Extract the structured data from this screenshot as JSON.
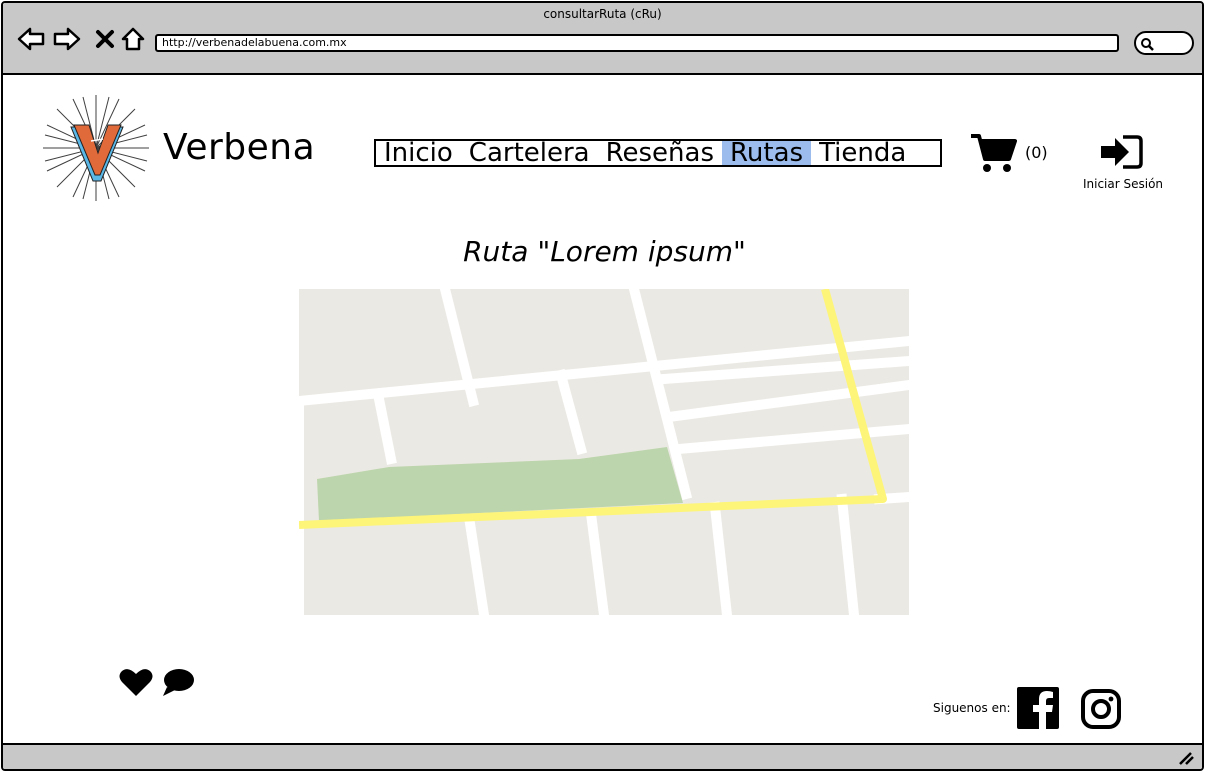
{
  "window": {
    "title": "consultarRuta (cRu)",
    "url": "http://verbenadelabuena.com.mx"
  },
  "header": {
    "brand": "Verbena",
    "nav": [
      {
        "label": "Inicio"
      },
      {
        "label": "Cartelera"
      },
      {
        "label": "Reseñas"
      },
      {
        "label": "Rutas",
        "active": true
      },
      {
        "label": "Tienda"
      }
    ],
    "cart_count": "(0)",
    "login_label": "Iniciar Sesión"
  },
  "main": {
    "route_title": "Ruta \"Lorem ipsum\""
  },
  "footer": {
    "follow_label": "Siguenos en:",
    "icons": [
      "heart-icon",
      "comment-icon",
      "facebook-icon",
      "instagram-icon"
    ]
  },
  "colors": {
    "active_nav": "#9bbcec",
    "map_background": "#ebe9e3",
    "route_line": "#fdf57a",
    "park": "#bdd5ac",
    "logo_orange": "#e06a3a",
    "logo_blue": "#5ab7e6"
  }
}
